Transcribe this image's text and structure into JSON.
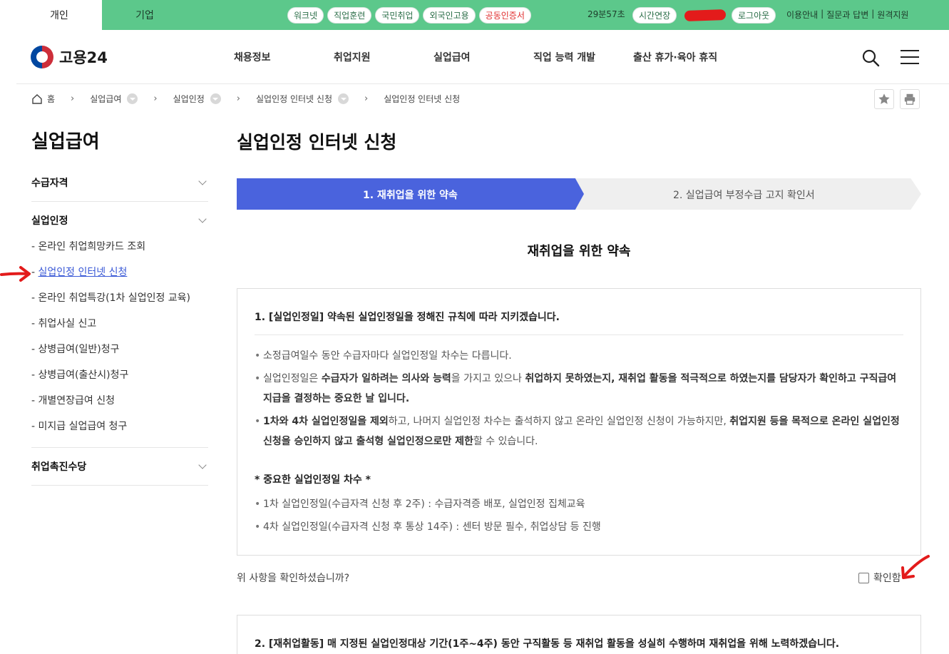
{
  "topbar": {
    "tabs": [
      {
        "label": "개인"
      },
      {
        "label": "기업"
      }
    ],
    "services": [
      "워크넷",
      "직업훈련",
      "국민취업",
      "외국인고용",
      "공동인증서"
    ],
    "session_time": "29분57초",
    "extend_label": "시간연장",
    "logout_label": "로그아웃",
    "util_links": [
      "이용안내",
      "|",
      "질문과 답변",
      "|",
      "원격지원"
    ]
  },
  "header": {
    "logo_text": "고용24",
    "gnb": [
      "채용정보",
      "취업지원",
      "실업급여",
      "직업 능력 개발",
      "출산 휴가·육아 휴직"
    ]
  },
  "breadcrumb": {
    "home": "홈",
    "items": [
      "실업급여",
      "실업인정",
      "실업인정 인터넷 신청",
      "실업인정 인터넷 신청"
    ]
  },
  "sidebar": {
    "title": "실업급여",
    "sections": [
      "수급자격",
      "실업인정",
      "취업촉진수당"
    ],
    "links": [
      "- 온라인 취업희망카드 조회",
      "실업인정 인터넷 신청",
      "- 온라인 취업특강(1차 실업인정 교육)",
      "- 취업사실 신고",
      "- 상병급여(일반)청구",
      "- 상병급여(출산시)청구",
      "- 개별연장급여 신청",
      "- 미지급 실업급여 청구"
    ],
    "current_prefix": "- "
  },
  "main": {
    "page_title": "실업인정 인터넷 신청",
    "steps": [
      "1. 재취업을 위한 약속",
      "2. 실업급여 부정수급 고지 확인서"
    ],
    "section_title": "재취업을 위한 약속",
    "item1": {
      "heading": "1. [실업인정일] 약속된 실업인정일을 정해진 규칙에 따라 지키겠습니다.",
      "b1": "소정급여일수 동안 수급자마다 실업인정일 차수는 다릅니다.",
      "b2_a": "실업인정일은 ",
      "b2_b": "수급자가 일하려는 의사와 능력",
      "b2_c": "을 가지고 있으나 ",
      "b2_d": "취업하지 못하였는지, 재취업 활동을 적극적으로 하였는지를 담당자가 확인하고 구직급여 지급을 결정하는 중요한 날 입니다.",
      "b3_a": "1차와 4차 실업인정일을 제외",
      "b3_b": "하고, 나머지 실업인정 차수는 출석하지 않고 온라인 실업인정 신청이 가능하지만, ",
      "b3_c": "취업지원 등을 목적으로 온라인 실업인정 신청을 승인하지 않고 출석형 실업인정으로만 제한",
      "b3_d": "할 수 있습니다.",
      "sub_heading": "* 중요한 실업인정일 차수 *",
      "b4": "1차 실업인정일(수급자격 신청 후 2주) : 수급자격증 배포, 실업인정 집체교육",
      "b5": "4차 실업인정일(수급자격 신청 후 통상 14주) : 센터 방문 필수, 취업상담 등 진행"
    },
    "confirm_question": "위 사항을 확인하셨습니까?",
    "confirm_label": "확인함",
    "item2": {
      "heading": "2. [재취업활동] 매 지정된 실업인정대상 기간(1주~4주) 동안 구직활동 등 재취업 활동을 성실히 수행하며 재취업을 위해 노력하겠습니다."
    }
  },
  "colors": {
    "topbar": "#5cc88b",
    "step_active": "#4a63dd",
    "link_current": "#3a59d6",
    "annotation": "#e31b1b"
  }
}
